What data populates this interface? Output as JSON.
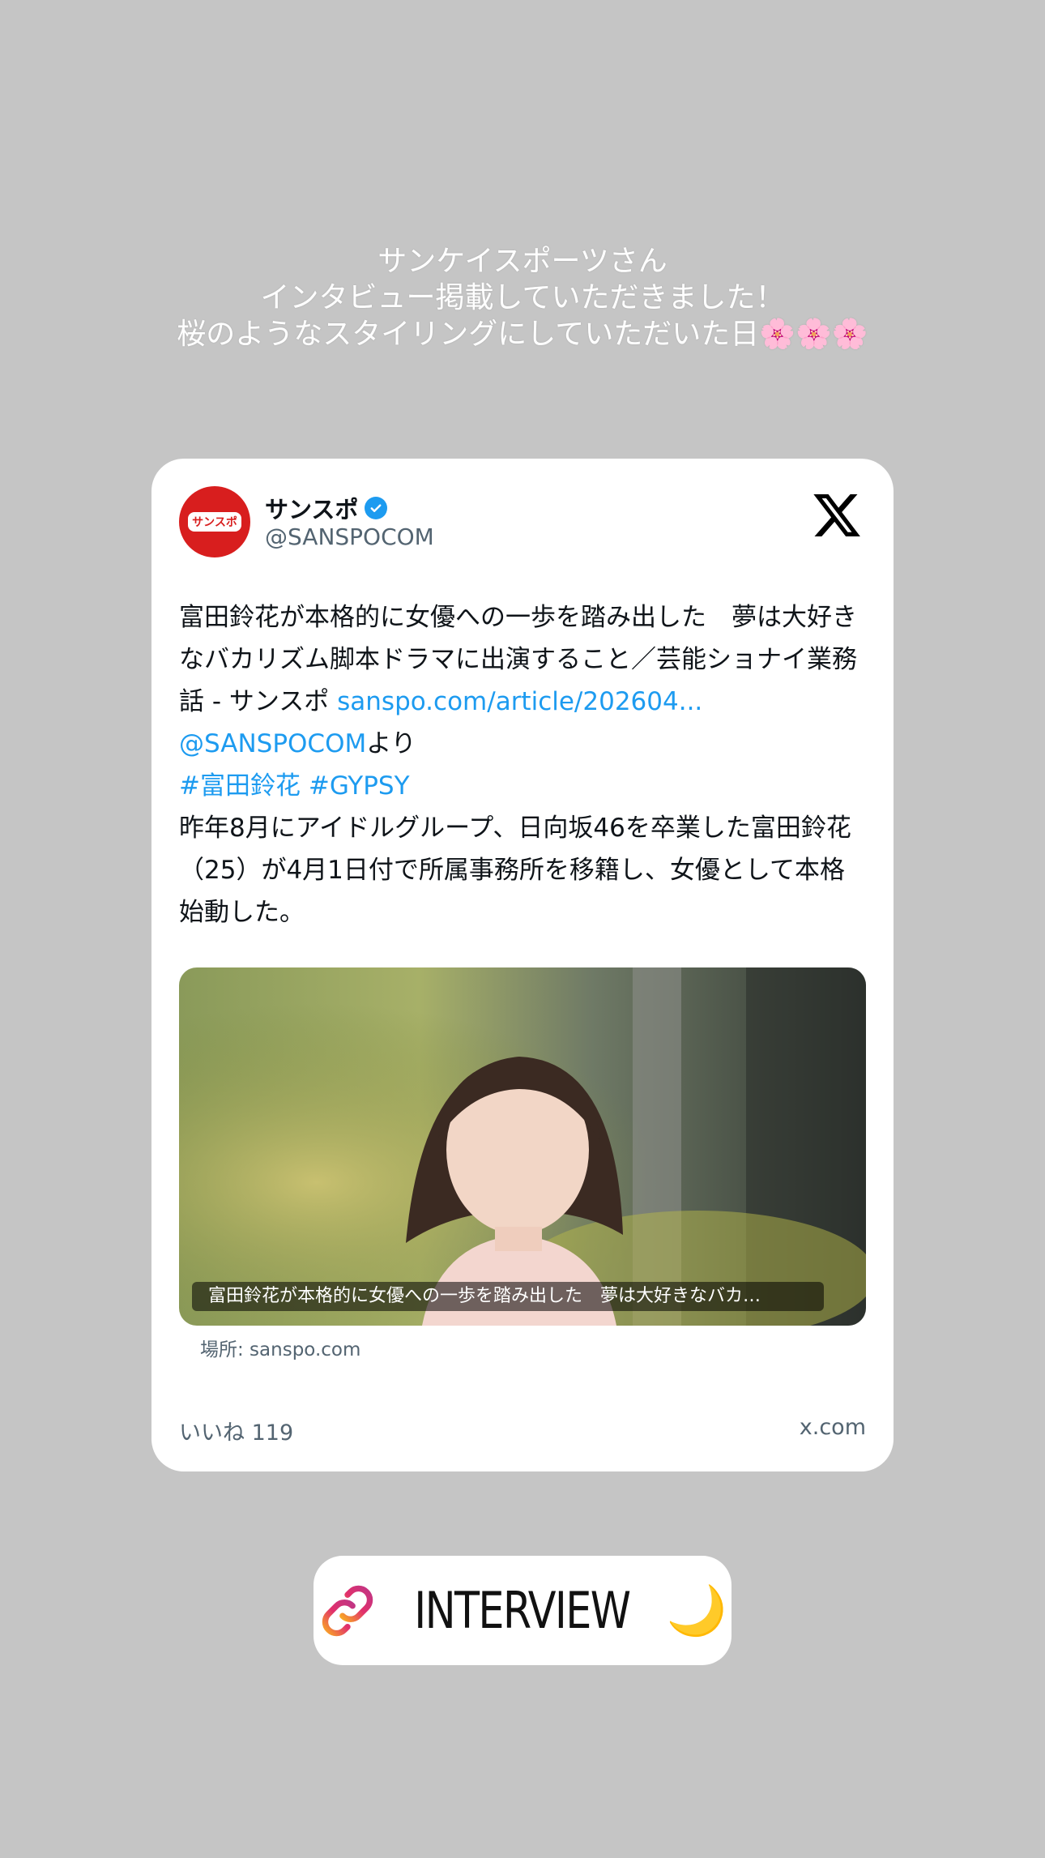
{
  "story": {
    "caption_lines": [
      "サンケイスポーツさん",
      "インタビュー掲載していただきました！",
      "桜のようなスタイリングにしていただいた日"
    ],
    "caption_emoji": "🌸🌸🌸"
  },
  "tweet": {
    "account_name": "サンスポ",
    "handle": "@SANSPOCOM",
    "avatar_text": "サンスポ",
    "text_part1": "富田鈴花が本格的に女優への一歩を踏み出した　夢は大好きなバカリズム脚本ドラマに出演すること／芸能ショナイ業務話 - サンスポ ",
    "text_link": "sanspo.com/article/202604...",
    "mention": "@SANSPOCOM",
    "mention_suffix": "より",
    "hashtag1": "#富田鈴花",
    "hashtag2": "#GYPSY",
    "text_part2": "昨年8月にアイドルグループ、日向坂46を卒業した富田鈴花（25）が4月1日付で所属事務所を移籍し、女優として本格始動した。",
    "media_caption": "富田鈴花が本格的に女優への一歩を踏み出した　夢は大好きなバカ…",
    "source": "場所: sanspo.com",
    "likes": "いいね 119",
    "site": "x.com"
  },
  "sticker": {
    "label": "INTERVIEW",
    "emoji": "🌙"
  },
  "colors": {
    "background": "#c5c5c5",
    "link_blue": "#1d9bf0",
    "verified_blue": "#1d9bf0",
    "avatar_red": "#d81e1e"
  },
  "icons": [
    "verified-badge-icon",
    "x-logo-icon",
    "link-icon",
    "moon-icon"
  ]
}
